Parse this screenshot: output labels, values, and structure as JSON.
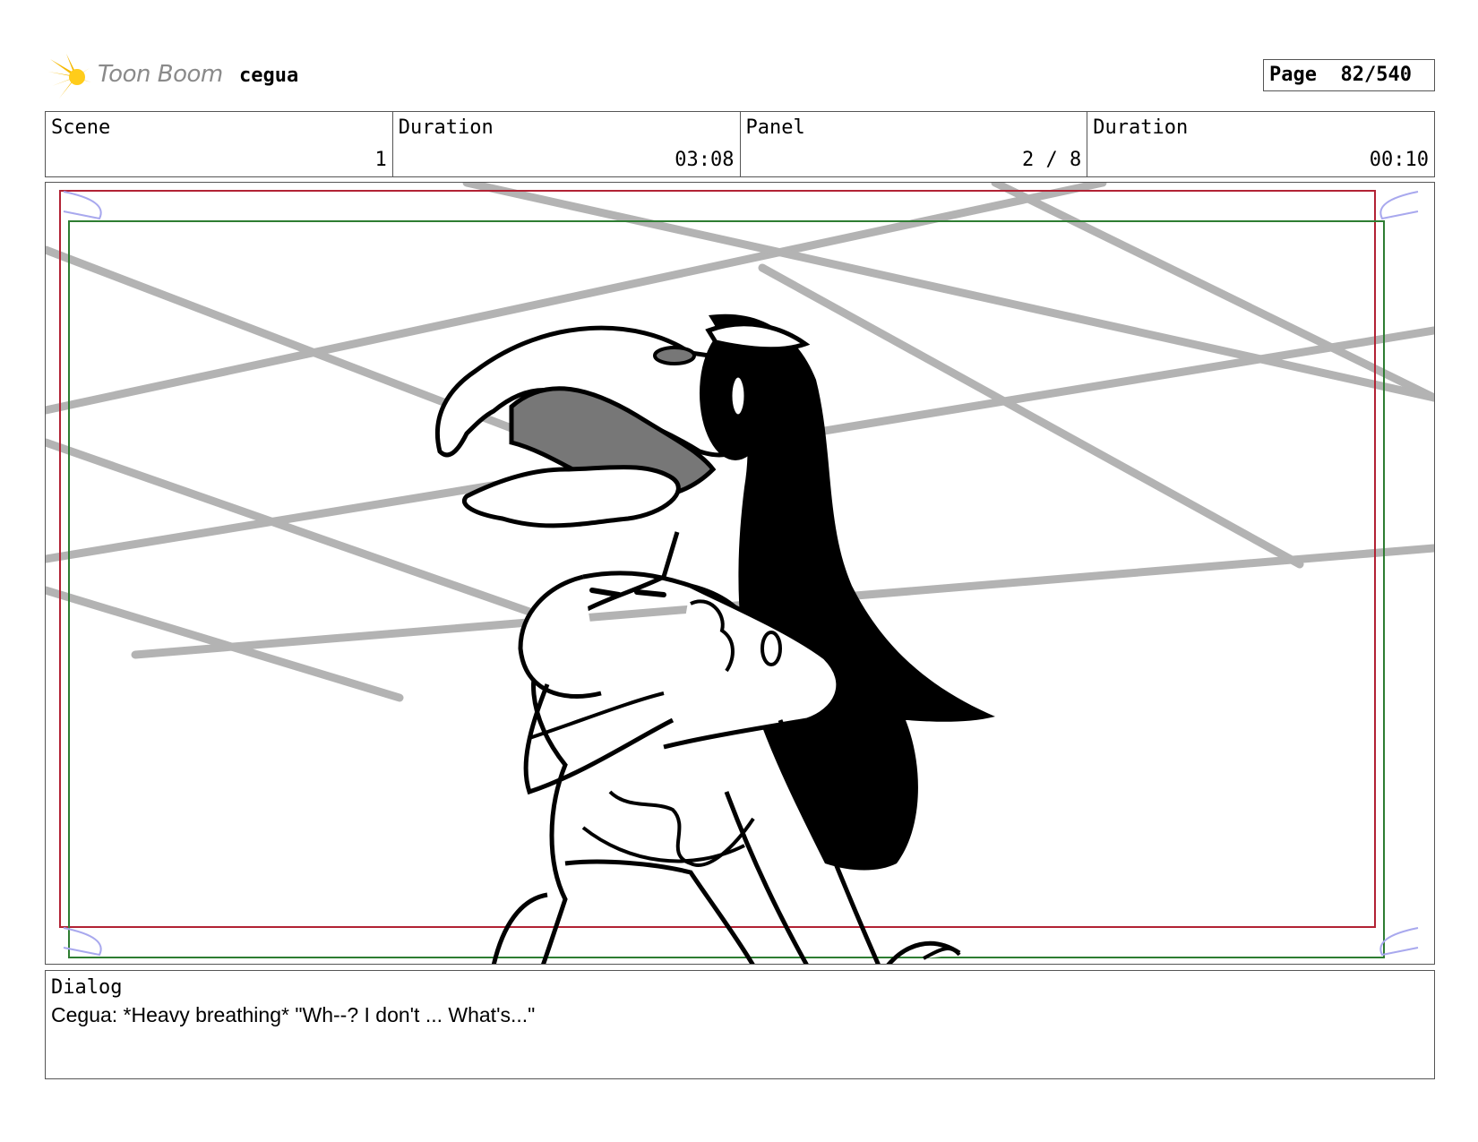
{
  "header": {
    "logo_text": "Toon Boom",
    "project_name": "cegua",
    "page_label": "Page",
    "page_value": "82/540"
  },
  "info": {
    "scene_label": "Scene",
    "scene_value": "1",
    "scene_duration_label": "Duration",
    "scene_duration_value": "03:08",
    "panel_label": "Panel",
    "panel_value": "2 / 8",
    "panel_duration_label": "Duration",
    "panel_duration_value": "00:10"
  },
  "dialog": {
    "label": "Dialog",
    "text": "Cegua: *Heavy breathing* \"Wh--? I don't ... What's...\""
  },
  "colors": {
    "safe_frame": "#b22234",
    "camera_frame": "#2e7d32",
    "background_lines": "#b3b3b3",
    "logo_accent": "#f5b800"
  }
}
